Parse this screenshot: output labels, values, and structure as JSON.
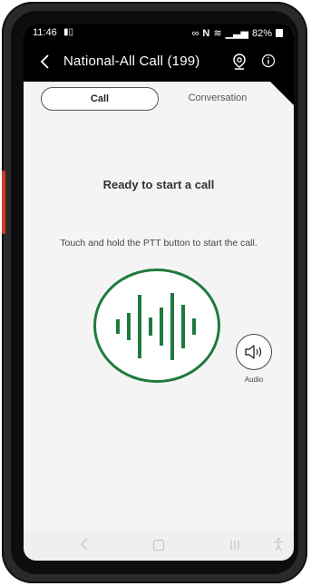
{
  "status_bar": {
    "time": "11:46",
    "left_icon": "notification-icon",
    "battery": "82%",
    "icons": [
      "link-icon",
      "nfc-icon",
      "wifi-icon",
      "signal-icon",
      "battery-icon"
    ]
  },
  "header": {
    "title": "National-All Call (199)",
    "back_icon": "back-arrow-icon",
    "location_icon": "location-pin-icon",
    "info_icon": "info-icon",
    "background": "#000000"
  },
  "tabs": [
    {
      "label": "Call",
      "selected": true
    },
    {
      "label": "Conversation",
      "selected": false
    }
  ],
  "main": {
    "title": "Ready to start a call",
    "instruction": "Touch and hold the PTT button to start the call.",
    "ptt_icon": "waveform-icon",
    "ptt_color": "#1f7a3e",
    "audio_label": "Audio",
    "audio_icon": "speaker-icon"
  },
  "nav_bar": {
    "icons": [
      "nav-back-icon",
      "nav-home-icon",
      "nav-recents-icon",
      "accessibility-icon"
    ]
  }
}
